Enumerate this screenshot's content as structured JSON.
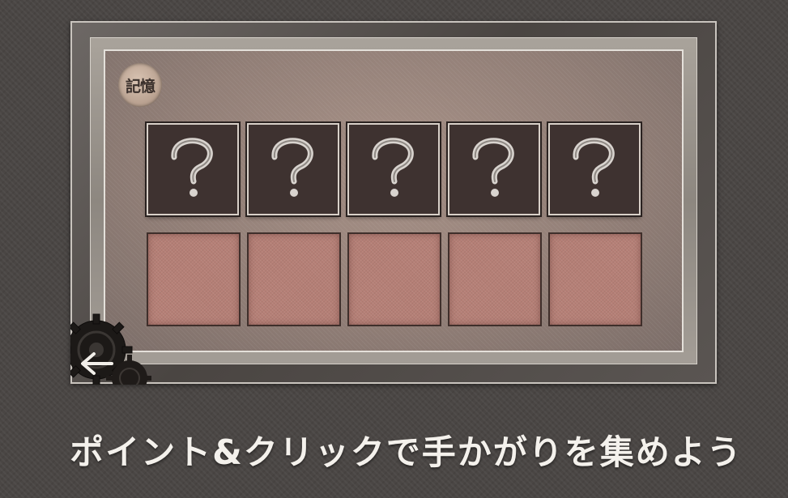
{
  "memory_badge": {
    "label": "記憶",
    "icon": "memory-badge-icon"
  },
  "clue_cards": [
    {
      "symbol": "?",
      "icon": "question-mark-icon"
    },
    {
      "symbol": "?",
      "icon": "question-mark-icon"
    },
    {
      "symbol": "?",
      "icon": "question-mark-icon"
    },
    {
      "symbol": "?",
      "icon": "question-mark-icon"
    },
    {
      "symbol": "?",
      "icon": "question-mark-icon"
    }
  ],
  "answer_slots": [
    {},
    {},
    {},
    {},
    {}
  ],
  "navigation": {
    "back_icon": "back-arrow-icon",
    "decoration_icon": "gear-icon"
  },
  "caption": "ポイント&クリックで手かがりを集めよう",
  "colors": {
    "background": "#4a4644",
    "card_face": "#3e3230",
    "answer_slot": "#b57f76",
    "caption_text": "#f4f1ec"
  }
}
